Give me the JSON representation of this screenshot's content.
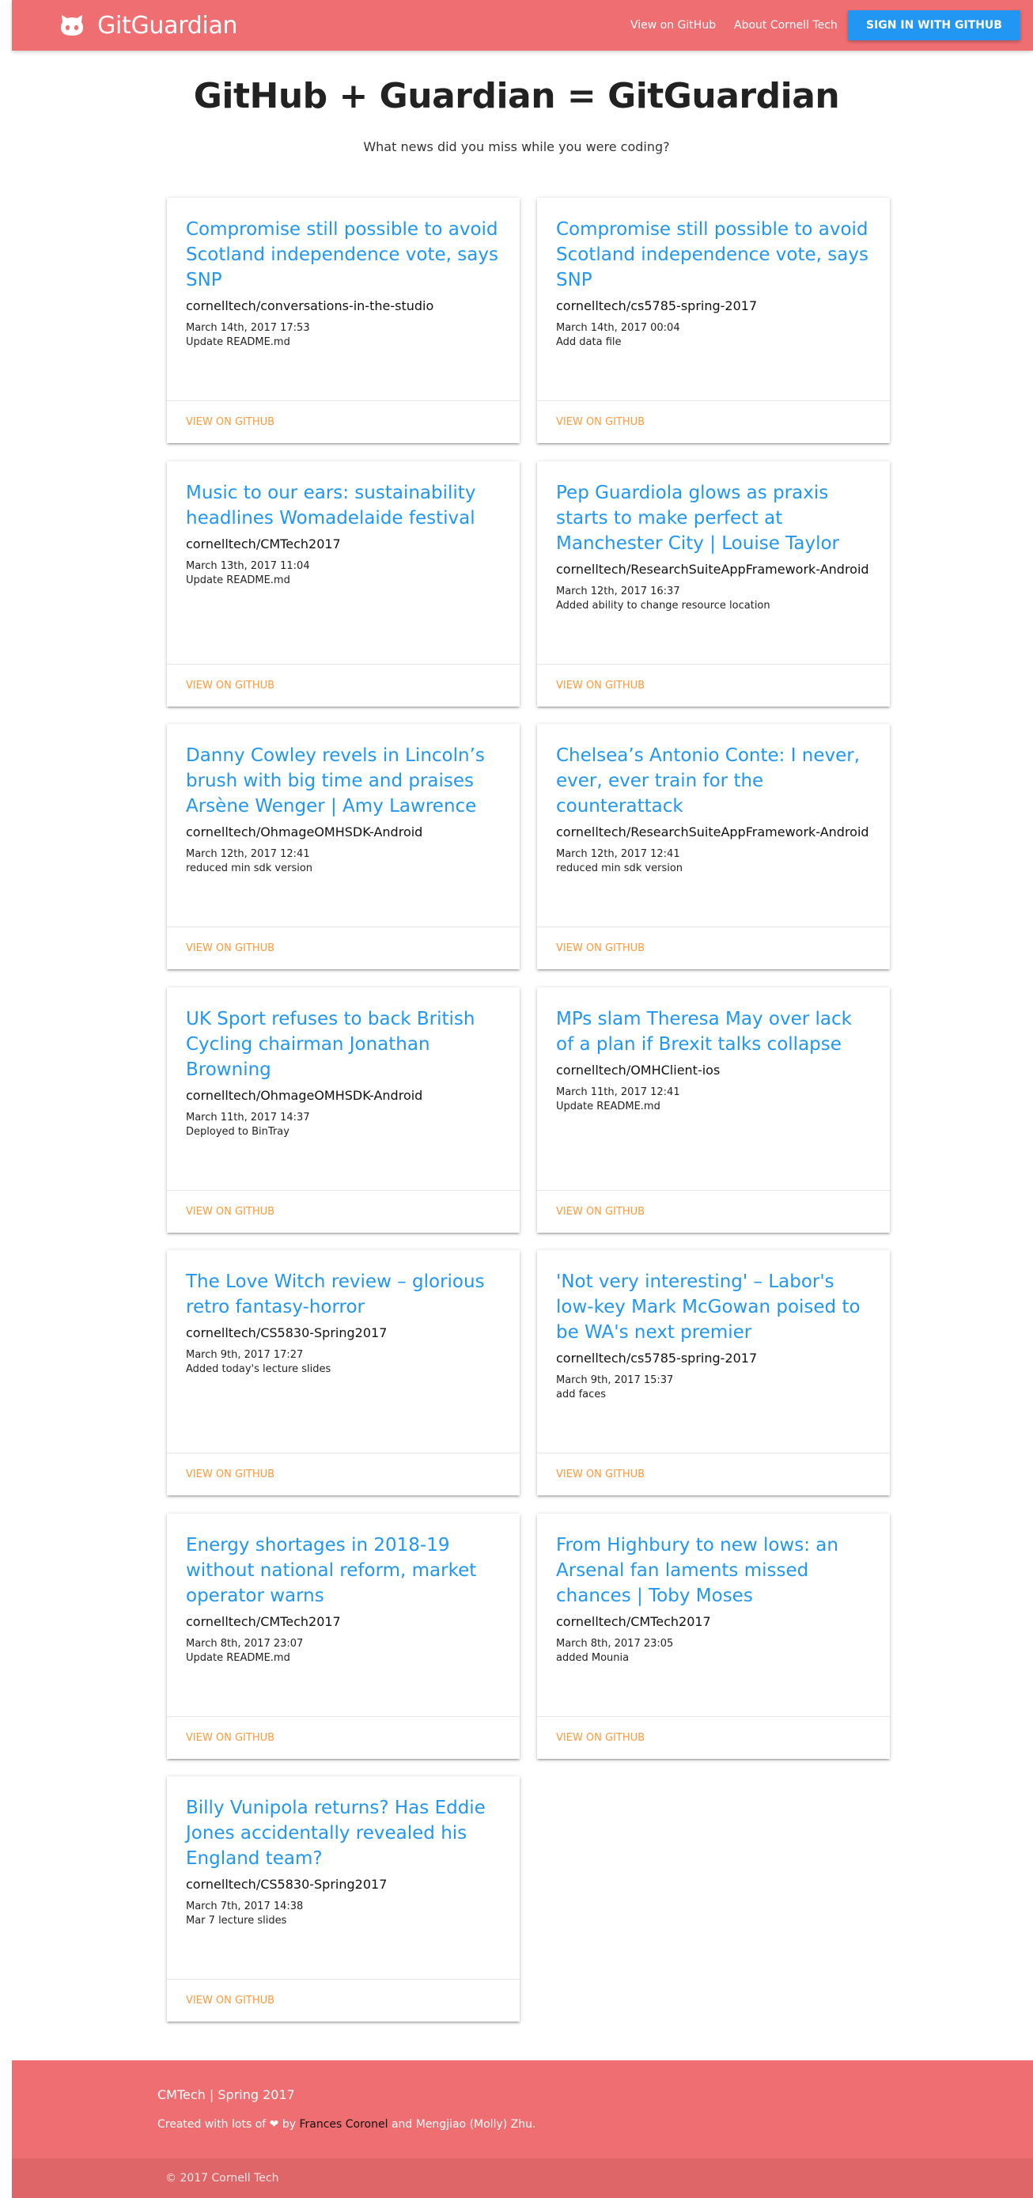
{
  "header": {
    "brand": "GitGuardian",
    "nav_github": "View on GitHub",
    "nav_about": "About Cornell Tech",
    "signin": "SIGN IN WITH GITHUB",
    "brand_color": "#ef6e72",
    "signin_color": "#2196f3"
  },
  "hero": {
    "title": "GitHub + Guardian = GitGuardian",
    "subtitle": "What news did you miss while you were coding?"
  },
  "cards": [
    {
      "headline": "Compromise still possible to avoid Scotland independence vote, says SNP",
      "repo": "cornelltech/conversations-in-the-studio",
      "date": "March 14th, 2017 17:53",
      "message": "Update README.md",
      "action": "VIEW ON GITHUB"
    },
    {
      "headline": "Compromise still possible to avoid Scotland independence vote, says SNP",
      "repo": "cornelltech/cs5785-spring-2017",
      "date": "March 14th, 2017 00:04",
      "message": "Add data file",
      "action": "VIEW ON GITHUB"
    },
    {
      "headline": "Music to our ears: sustainability headlines Womadelaide festival",
      "repo": "cornelltech/CMTech2017",
      "date": "March 13th, 2017 11:04",
      "message": "Update README.md",
      "action": "VIEW ON GITHUB"
    },
    {
      "headline": "Pep Guardiola glows as praxis starts to make perfect at Manchester City | Louise Taylor",
      "repo": "cornelltech/ResearchSuiteAppFramework-Android",
      "date": "March 12th, 2017 16:37",
      "message": "Added ability to change resource location",
      "action": "VIEW ON GITHUB"
    },
    {
      "headline": "Danny Cowley revels in Lincoln’s brush with big time and praises Arsène Wenger | Amy Lawrence",
      "repo": "cornelltech/OhmageOMHSDK-Android",
      "date": "March 12th, 2017 12:41",
      "message": "reduced min sdk version",
      "action": "VIEW ON GITHUB"
    },
    {
      "headline": "Chelsea’s Antonio Conte: I never, ever, ever train for the counterattack",
      "repo": "cornelltech/ResearchSuiteAppFramework-Android",
      "date": "March 12th, 2017 12:41",
      "message": "reduced min sdk version",
      "action": "VIEW ON GITHUB"
    },
    {
      "headline": "UK Sport refuses to back British Cycling chairman Jonathan Browning",
      "repo": "cornelltech/OhmageOMHSDK-Android",
      "date": "March 11th, 2017 14:37",
      "message": "Deployed to BinTray",
      "action": "VIEW ON GITHUB"
    },
    {
      "headline": "MPs slam Theresa May over lack of a plan if Brexit talks collapse",
      "repo": "cornelltech/OMHClient-ios",
      "date": "March 11th, 2017 12:41",
      "message": "Update README.md",
      "action": "VIEW ON GITHUB"
    },
    {
      "headline": "The Love Witch review – glorious retro fantasy-horror",
      "repo": "cornelltech/CS5830-Spring2017",
      "date": "March 9th, 2017 17:27",
      "message": "Added today's lecture slides",
      "action": "VIEW ON GITHUB"
    },
    {
      "headline": "'Not very interesting' – Labor's low-key Mark McGowan poised to be WA's next premier",
      "repo": "cornelltech/cs5785-spring-2017",
      "date": "March 9th, 2017 15:37",
      "message": "add faces",
      "action": "VIEW ON GITHUB"
    },
    {
      "headline": "Energy shortages in 2018-19 without national reform, market operator warns",
      "repo": "cornelltech/CMTech2017",
      "date": "March 8th, 2017 23:07",
      "message": "Update README.md",
      "action": "VIEW ON GITHUB"
    },
    {
      "headline": "From Highbury to new lows: an Arsenal fan laments missed chances | Toby Moses",
      "repo": "cornelltech/CMTech2017",
      "date": "March 8th, 2017 23:05",
      "message": "added Mounia",
      "action": "VIEW ON GITHUB"
    },
    {
      "headline": "Billy Vunipola returns? Has Eddie Jones accidentally revealed his England team?",
      "repo": "cornelltech/CS5830-Spring2017",
      "date": "March 7th, 2017 14:38",
      "message": "Mar 7 lecture slides",
      "action": "VIEW ON GITHUB"
    }
  ],
  "footer": {
    "title": "CMTech | Spring 2017",
    "credit_prefix": "Created with lots of",
    "credit_by": "by",
    "credit_name": "Frances Coronel",
    "credit_suffix": "and Mengjiao (Molly) Zhu.",
    "copyright": "© 2017 Cornell Tech"
  }
}
